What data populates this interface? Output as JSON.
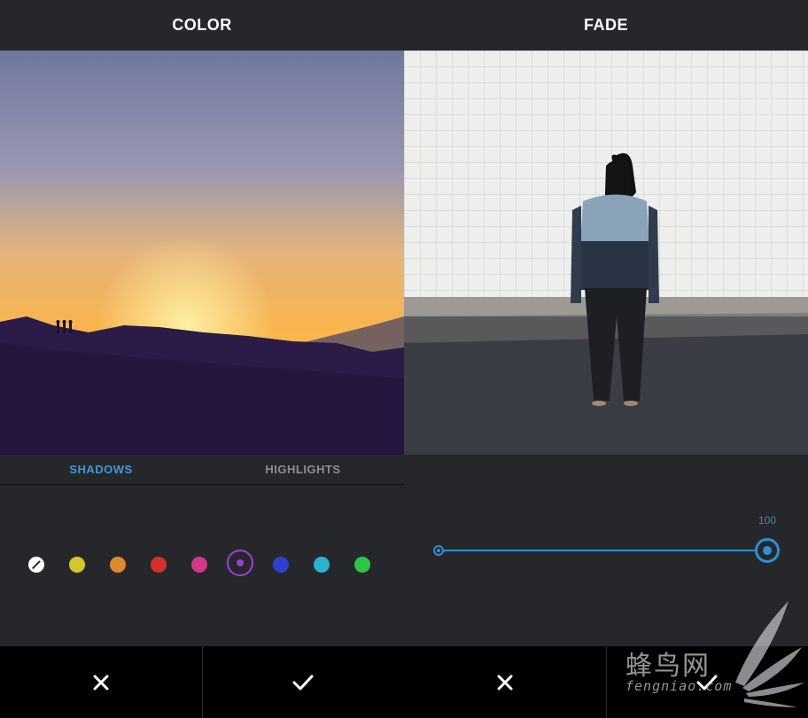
{
  "left_panel": {
    "title": "COLOR",
    "tabs": [
      {
        "label": "SHADOWS",
        "active": true
      },
      {
        "label": "HIGHLIGHTS",
        "active": false
      }
    ],
    "swatches": [
      {
        "name": "none",
        "color": "#ffffff"
      },
      {
        "name": "yellow",
        "color": "#d7c52c"
      },
      {
        "name": "orange",
        "color": "#dc8b2b"
      },
      {
        "name": "red",
        "color": "#d5312c"
      },
      {
        "name": "pink",
        "color": "#d2398a"
      },
      {
        "name": "purple",
        "color": "#9b3fd9",
        "selected": true
      },
      {
        "name": "blue",
        "color": "#2e3fd2"
      },
      {
        "name": "cyan",
        "color": "#2cb1d2"
      },
      {
        "name": "green",
        "color": "#2ec545"
      }
    ],
    "cancel_icon": "close-icon",
    "confirm_icon": "check-icon"
  },
  "right_panel": {
    "title": "FADE",
    "slider": {
      "value": "100",
      "fraction": 1.0
    },
    "cancel_icon": "close-icon",
    "confirm_icon": "check-icon"
  },
  "watermark": {
    "text_cn": "蜂鸟网",
    "text_en": "fengniao.com"
  },
  "colors": {
    "accent": "#3f97d8",
    "panel_bg": "#26272b",
    "toolbar_bg": "#000000"
  }
}
